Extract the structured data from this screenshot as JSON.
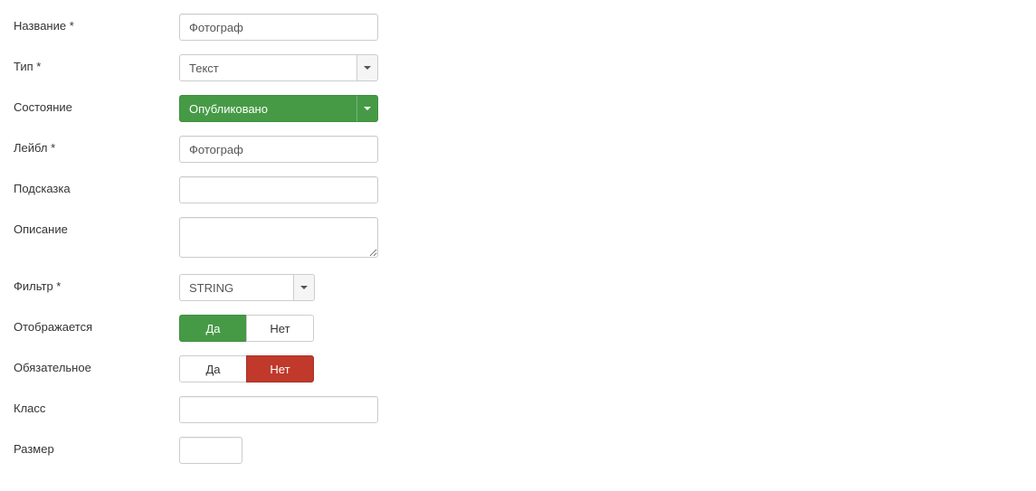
{
  "labels": {
    "name": "Название *",
    "type": "Тип *",
    "state": "Состояние",
    "label": "Лейбл *",
    "hint": "Подсказка",
    "description": "Описание",
    "filter": "Фильтр *",
    "visible": "Отображается",
    "required": "Обязательное",
    "class": "Класс",
    "size": "Размер"
  },
  "values": {
    "name": "Фотограф",
    "type": "Текст",
    "state": "Опубликовано",
    "label": "Фотограф",
    "hint": "",
    "description": "",
    "filter": "STRING",
    "class": "",
    "size": ""
  },
  "toggle": {
    "yes": "Да",
    "no": "Нет",
    "visible_active": "yes",
    "required_active": "no"
  }
}
